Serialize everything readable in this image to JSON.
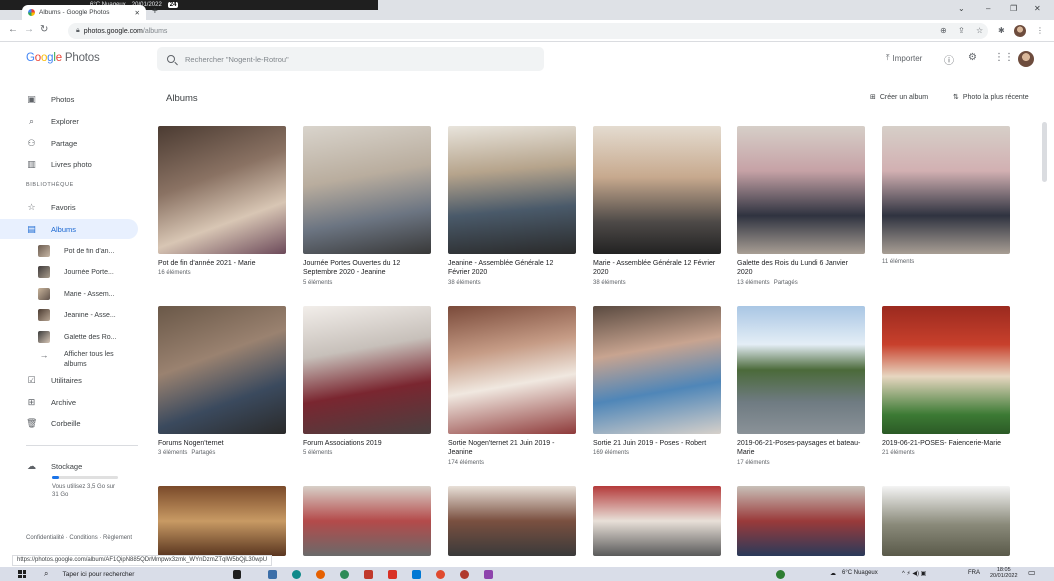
{
  "system": {
    "weather": "6°C  Nuageux",
    "date": "20/01/2022",
    "badge": "24"
  },
  "browser": {
    "tab_title": "Albums - Google Photos",
    "new_tab": "+",
    "url_host": "photos.google.com",
    "url_path": "/albums",
    "status_url": "https://photos.google.com/album/AF1QipN885QDrMmpwx3zmk_WYnDzmZTqlW5bQjL30wpU"
  },
  "header": {
    "logo_google": "Google",
    "logo_photos": "Photos",
    "search_placeholder": "Rechercher \"Nogent-le-Rotrou\"",
    "import_label": "Importer"
  },
  "sidebar": {
    "photos": "Photos",
    "explorer": "Explorer",
    "partage": "Partage",
    "livres": "Livres photo",
    "section": "BIBLIOTHÈQUE",
    "favoris": "Favoris",
    "albums": "Albums",
    "sub_albums": [
      "Pot de fin d'an...",
      "Journée Porte...",
      "Marie - Assem...",
      "Jeanine - Asse...",
      "Galette des Ro..."
    ],
    "show_all": "Afficher tous les albums",
    "utilitaires": "Utilitaires",
    "archive": "Archive",
    "corbeille": "Corbeille",
    "storage_label": "Stockage",
    "storage_used_text": "Vous utilisez 3,5 Go sur 31 Go",
    "storage_used_fraction": 0.11,
    "footer": "Confidentialité · Conditions · Règlement"
  },
  "main": {
    "title": "Albums",
    "create_album": "Créer un album",
    "sort": "Photo la plus récente",
    "albums": [
      {
        "title": "Pot de fin d'année 2021 - Marie",
        "count": "16 éléments",
        "shared": ""
      },
      {
        "title": "Journée Portes Ouvertes du 12 Septembre 2020 - Jeanine",
        "count": "5 éléments",
        "shared": ""
      },
      {
        "title": "Jeanine - Assemblée Générale 12 Février 2020",
        "count": "38 éléments",
        "shared": ""
      },
      {
        "title": "Marie - Assemblée Générale 12 Février 2020",
        "count": "38 éléments",
        "shared": ""
      },
      {
        "title": "Galette des Rois du Lundi 6 Janvier 2020",
        "count": "13 éléments",
        "shared": "Partagés"
      },
      {
        "title": "",
        "count": "11 éléments",
        "shared": ""
      },
      {
        "title": "Forums Nogen'ternet",
        "count": "3 éléments",
        "shared": "Partagés"
      },
      {
        "title": "Forum Associations 2019",
        "count": "5 éléments",
        "shared": ""
      },
      {
        "title": "Sortie Nogen'ternet 21 Juin 2019 - Jeanine",
        "count": "174 éléments",
        "shared": ""
      },
      {
        "title": "Sortie 21 Juin 2019 - Poses - Robert",
        "count": "169 éléments",
        "shared": ""
      },
      {
        "title": "2019-06-21-Poses-paysages et bateau-Marie",
        "count": "17 éléments",
        "shared": ""
      },
      {
        "title": "2019-06-21-POSES- Faiencerie-Marie",
        "count": "21 éléments",
        "shared": ""
      }
    ]
  },
  "taskbar": {
    "search_placeholder": "Taper ici pour rechercher",
    "weather": "6°C  Nuageux",
    "lang": "FRA",
    "time": "18:05",
    "date": "20/01/2022"
  }
}
